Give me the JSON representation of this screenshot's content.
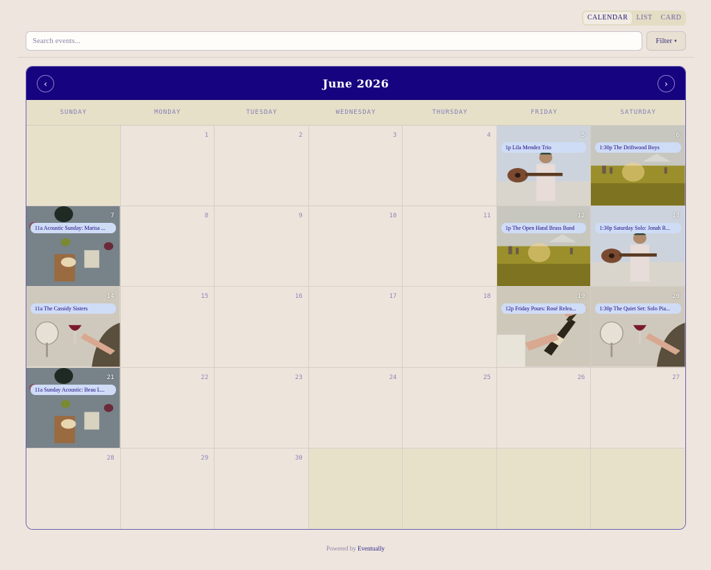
{
  "view_toggle": {
    "calendar": "CALENDAR",
    "list": "LIST",
    "card": "CARD",
    "active": "calendar"
  },
  "search": {
    "placeholder": "Search events...",
    "value": ""
  },
  "filter": {
    "label": "Filter",
    "caret": "▾"
  },
  "calendar": {
    "title": "June 2026",
    "prev_glyph": "‹",
    "next_glyph": "›",
    "weekdays": [
      "SUNDAY",
      "MONDAY",
      "TUESDAY",
      "WEDNESDAY",
      "THURSDAY",
      "FRIDAY",
      "SATURDAY"
    ],
    "cells": [
      {
        "day": "",
        "empty": true
      },
      {
        "day": "1"
      },
      {
        "day": "2"
      },
      {
        "day": "3"
      },
      {
        "day": "4"
      },
      {
        "day": "5",
        "event": "1p Lila Mendez Trio",
        "photo": "guitar"
      },
      {
        "day": "6",
        "event": "1:30p The Driftwood Boys",
        "photo": "field"
      },
      {
        "day": "7",
        "event": "11a Acoustic Sunday: Marisa ...",
        "photo": "picnic"
      },
      {
        "day": "8"
      },
      {
        "day": "9"
      },
      {
        "day": "10"
      },
      {
        "day": "11"
      },
      {
        "day": "12",
        "event": "1p The Open Hand Brass Band",
        "photo": "field"
      },
      {
        "day": "13",
        "event": "1:30p Saturday Solo: Jonah R...",
        "photo": "guitar"
      },
      {
        "day": "14",
        "event": "11a The Cassidy Sisters",
        "photo": "wine"
      },
      {
        "day": "15"
      },
      {
        "day": "16"
      },
      {
        "day": "17"
      },
      {
        "day": "18"
      },
      {
        "day": "19",
        "event": "12p Friday Pours: Rosé Relea...",
        "photo": "bottle"
      },
      {
        "day": "20",
        "event": "1:30p The Quiet Set: Solo Pia...",
        "photo": "wine"
      },
      {
        "day": "21",
        "event": "11a Sunday Acoustic: Beau L...",
        "photo": "picnic"
      },
      {
        "day": "22"
      },
      {
        "day": "23"
      },
      {
        "day": "24"
      },
      {
        "day": "25"
      },
      {
        "day": "26"
      },
      {
        "day": "27"
      },
      {
        "day": "28"
      },
      {
        "day": "29"
      },
      {
        "day": "30"
      },
      {
        "day": "",
        "empty": true
      },
      {
        "day": "",
        "empty": true
      },
      {
        "day": "",
        "empty": true
      },
      {
        "day": "",
        "empty": true
      }
    ]
  },
  "footer": {
    "prefix": "Powered by",
    "brand": "Eventually"
  },
  "colors": {
    "header": "#16037f",
    "pill": "#cfdcf6",
    "background": "#eee6de",
    "empty_cell": "#e8e1ca"
  }
}
